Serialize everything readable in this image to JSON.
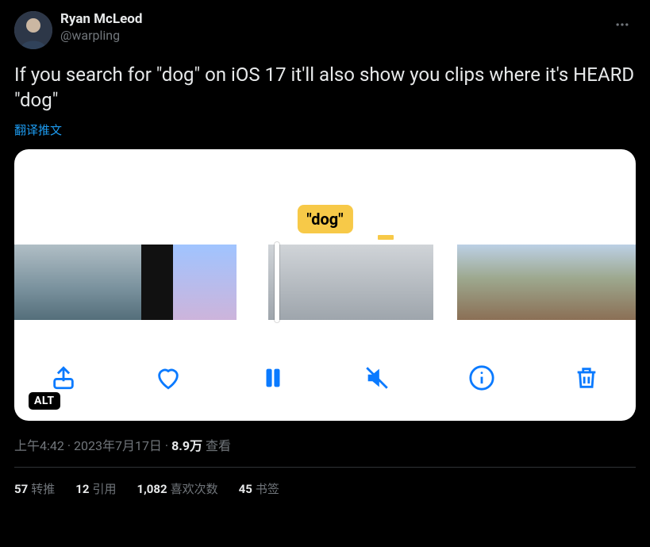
{
  "author": {
    "display_name": "Ryan McLeod",
    "handle": "@warpling"
  },
  "tweet_text": "If you search for \"dog\" on iOS 17 it'll also show you clips where it's HEARD \"dog\"",
  "translate_label": "翻译推文",
  "media": {
    "badge_text": "\"dog\"",
    "alt_label": "ALT",
    "controls": {
      "share": "share",
      "like": "like",
      "pause": "pause",
      "mute": "mute",
      "info": "info",
      "delete": "delete"
    }
  },
  "meta": {
    "time": "上午4:42",
    "date": "2023年7月17日",
    "separator": " · ",
    "views_count": "8.9万",
    "views_label": " 查看"
  },
  "stats": {
    "retweets_count": "57",
    "retweets_label": "转推",
    "quotes_count": "12",
    "quotes_label": "引用",
    "likes_count": "1,082",
    "likes_label": "喜欢次数",
    "bookmarks_count": "45",
    "bookmarks_label": "书签"
  }
}
